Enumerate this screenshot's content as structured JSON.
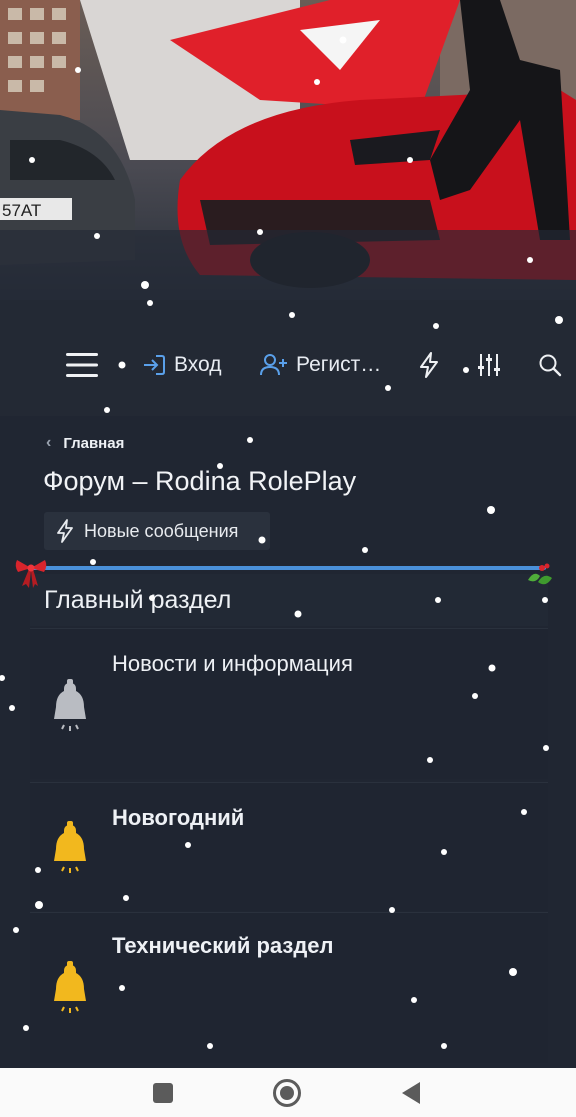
{
  "nav": {
    "login_label": "Вход",
    "register_label": "Регист…"
  },
  "breadcrumb": {
    "label": "Главная"
  },
  "page": {
    "title": "Форум – Rodina RolePlay",
    "new_posts_label": "Новые сообщения"
  },
  "section": {
    "title": "Главный раздел",
    "nodes": [
      {
        "title": "Новости и информация",
        "icon": "bell-icon",
        "icon_color": "#b9bcc2"
      },
      {
        "title": "Новогодний",
        "icon": "bell-icon",
        "icon_color": "#f2b81e"
      },
      {
        "title": "Технический раздел",
        "icon": "bell-icon",
        "icon_color": "#f2b81e"
      }
    ]
  },
  "banner": {
    "plate_text": "57АТ"
  },
  "colors": {
    "accent": "#4a90d9",
    "background": "#1f2530",
    "bell_gold": "#f2b81e",
    "bell_grey": "#b9bcc2"
  }
}
